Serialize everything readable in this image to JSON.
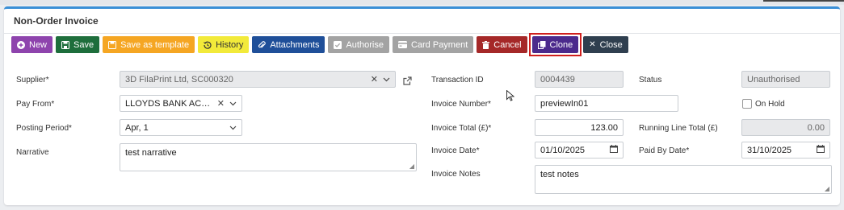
{
  "panel": {
    "title": "Non-Order Invoice"
  },
  "toolbar": {
    "new": "New",
    "save": "Save",
    "save_template": "Save as template",
    "history": "History",
    "attachments": "Attachments",
    "authorise": "Authorise",
    "card_payment": "Card Payment",
    "cancel": "Cancel",
    "clone": "Clone",
    "close": "Close"
  },
  "form": {
    "supplier": {
      "label": "Supplier*",
      "value": "3D FilaPrint Ltd, SC000320"
    },
    "pay_from": {
      "label": "Pay From*",
      "value": "LLOYDS BANK ACCOU..."
    },
    "posting_period": {
      "label": "Posting Period*",
      "value": "Apr, 1"
    },
    "narrative": {
      "label": "Narrative",
      "value": "test narrative"
    },
    "transaction_id": {
      "label": "Transaction ID",
      "value": "0004439"
    },
    "invoice_number": {
      "label": "Invoice Number*",
      "value": "previewIn01"
    },
    "invoice_total": {
      "label": "Invoice Total (£)*",
      "value": "123.00"
    },
    "invoice_date": {
      "label": "Invoice Date*",
      "value": "01/10/2025"
    },
    "invoice_notes": {
      "label": "Invoice Notes",
      "value": "test notes"
    },
    "status": {
      "label": "Status",
      "value": "Unauthorised"
    },
    "on_hold": {
      "label": "On Hold",
      "checked": false
    },
    "running_line_total": {
      "label": "Running Line Total (£)",
      "value": "0.00"
    },
    "paid_by_date": {
      "label": "Paid By Date*",
      "value": "31/10/2025"
    }
  },
  "colors": {
    "new": "#8e44ad",
    "save": "#1e6e3c",
    "template": "#f5a623",
    "history": "#f2ea3a",
    "attachments": "#1f4f99",
    "authorise": "#a3a3a3",
    "cancel": "#a52828",
    "clone": "#4b2a8c",
    "close": "#2f3f4f",
    "highlight": "#d0201e",
    "accent": "#3a8fd6"
  }
}
